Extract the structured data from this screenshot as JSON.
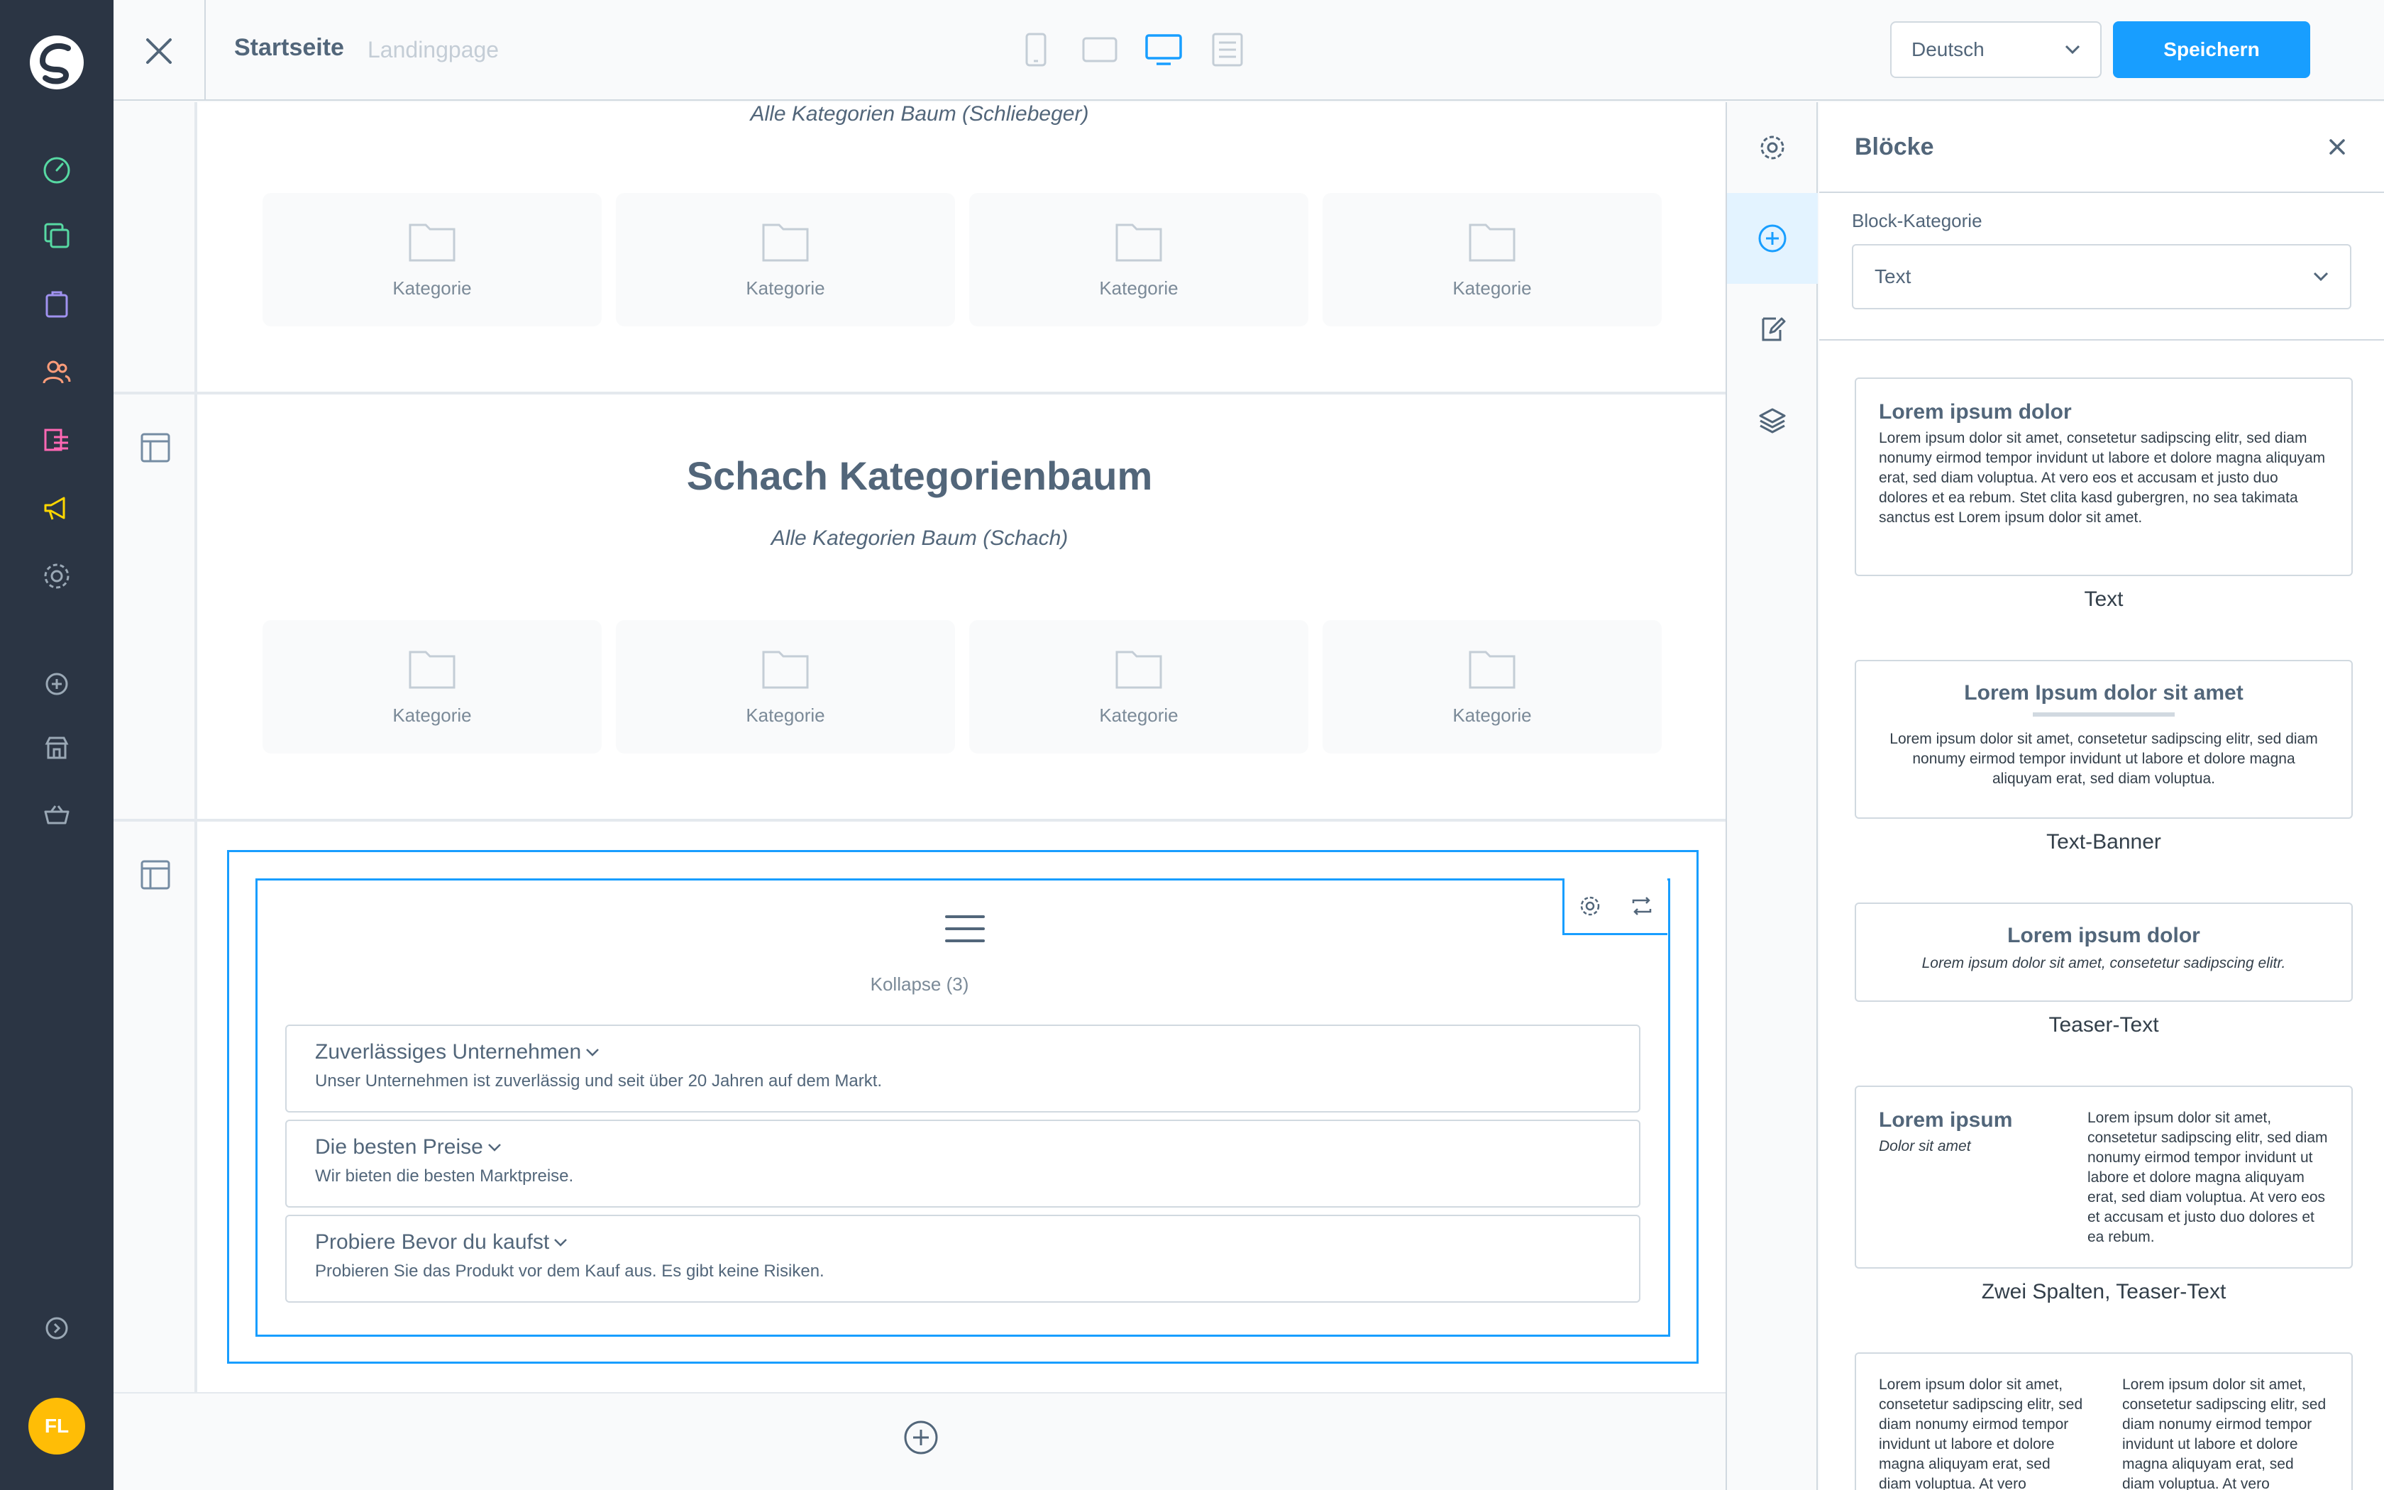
{
  "app": {
    "user_initials": "FL"
  },
  "topbar": {
    "page_title": "Startseite",
    "page_type": "Landingpage",
    "language": "Deutsch",
    "save_label": "Speichern"
  },
  "canvas": {
    "section1": {
      "subtitle": "Alle Kategorien Baum (Schliebeger)",
      "categories": [
        "Kategorie",
        "Kategorie",
        "Kategorie",
        "Kategorie"
      ]
    },
    "section2": {
      "title": "Schach Kategorienbaum",
      "subtitle": "Alle Kategorien Baum (Schach)",
      "categories": [
        "Kategorie",
        "Kategorie",
        "Kategorie",
        "Kategorie"
      ]
    },
    "section3": {
      "label": "Kollapse (3)",
      "items": [
        {
          "title": "Zuverlässiges Unternehmen",
          "body": "Unser Unternehmen ist zuverlässig und seit über 20 Jahren auf dem Markt."
        },
        {
          "title": "Die besten Preise",
          "body": "Wir bieten die besten Marktpreise."
        },
        {
          "title": "Probiere Bevor du kaufst",
          "body": "Probieren Sie das Produkt vor dem Kauf aus. Es gibt keine Risiken."
        }
      ]
    }
  },
  "sidebar": {
    "title": "Blöcke",
    "category_label": "Block-Kategorie",
    "category_value": "Text",
    "blocks": [
      {
        "name": "Text",
        "heading": "Lorem ipsum dolor",
        "body": "Lorem ipsum dolor sit amet, consetetur sadipscing elitr, sed diam nonumy eirmod tempor invidunt ut labore et dolore magna aliquyam erat, sed diam voluptua. At vero eos et accusam et justo duo dolores et ea rebum. Stet clita kasd gubergren, no sea takimata sanctus est Lorem ipsum dolor sit amet."
      },
      {
        "name": "Text-Banner",
        "heading": "Lorem Ipsum dolor sit amet",
        "body": "Lorem ipsum dolor sit amet, consetetur sadipscing elitr, sed diam nonumy eirmod tempor invidunt ut labore et dolore magna aliquyam erat, sed diam voluptua."
      },
      {
        "name": "Teaser-Text",
        "heading": "Lorem ipsum dolor",
        "body": "Lorem ipsum dolor sit amet, consetetur sadipscing elitr."
      },
      {
        "name": "Zwei Spalten, Teaser-Text",
        "heading": "Lorem ipsum",
        "subheading": "Dolor sit amet",
        "body": "Lorem ipsum dolor sit amet, consetetur sadipscing elitr, sed diam nonumy eirmod tempor invidunt ut labore et dolore magna aliquyam erat, sed diam voluptua. At vero eos et accusam et justo duo dolores et ea rebum."
      },
      {
        "col1": "Lorem ipsum dolor sit amet, consetetur sadipscing elitr, sed diam nonumy eirmod tempor invidunt ut labore et dolore magna aliquyam erat, sed diam voluptua. At vero",
        "col2": "Lorem ipsum dolor sit amet, consetetur sadipscing elitr, sed diam nonumy eirmod tempor invidunt ut labore et dolore magna aliquyam erat, sed diam voluptua. At vero"
      }
    ]
  }
}
